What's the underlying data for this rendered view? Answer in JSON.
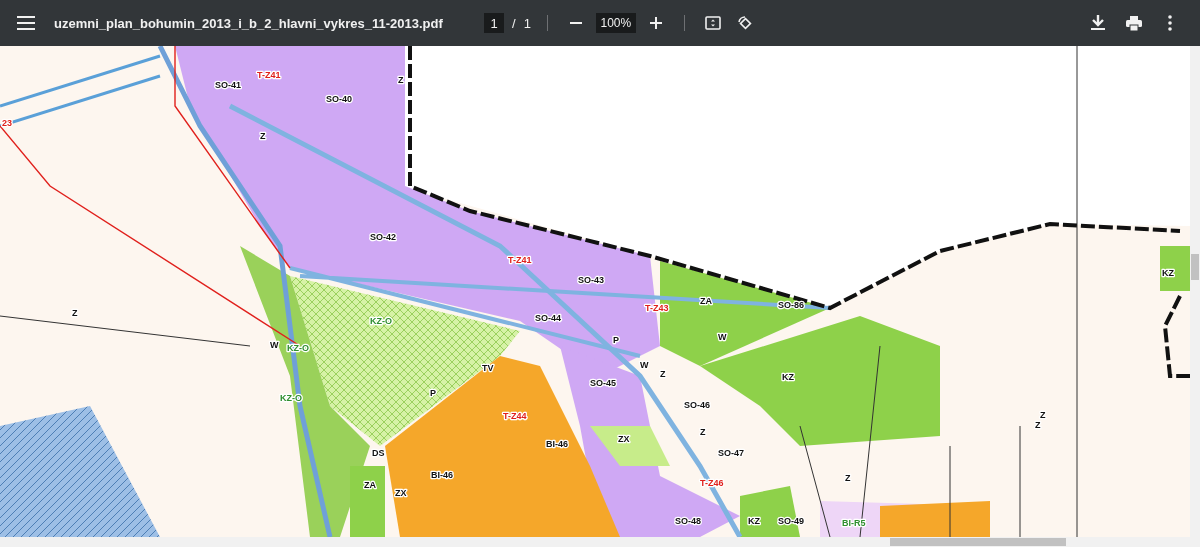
{
  "toolbar": {
    "title": "uzemni_plan_bohumin_2013_i_b_2_hlavni_vykres_11-2013.pdf",
    "page_current": "1",
    "page_separator": "/",
    "page_total": "1",
    "zoom": "100%"
  },
  "map_labels": [
    {
      "text": "SO-41",
      "kind": "zone"
    },
    {
      "text": "T-Z41",
      "kind": "plot"
    },
    {
      "text": "SO-40",
      "kind": "zone"
    },
    {
      "text": "Z",
      "kind": "zone"
    },
    {
      "text": "Z",
      "kind": "zone"
    },
    {
      "text": "SO-42",
      "kind": "zone"
    },
    {
      "text": "T-Z41",
      "kind": "plot"
    },
    {
      "text": "SO-43",
      "kind": "zone"
    },
    {
      "text": "SO-44",
      "kind": "zone"
    },
    {
      "text": "T-Z43",
      "kind": "plot"
    },
    {
      "text": "ZA",
      "kind": "zone"
    },
    {
      "text": "SO-86",
      "kind": "zone"
    },
    {
      "text": "W",
      "kind": "zone"
    },
    {
      "text": "W",
      "kind": "zone"
    },
    {
      "text": "KZ",
      "kind": "zone"
    },
    {
      "text": "KZ",
      "kind": "zone"
    },
    {
      "text": "Z",
      "kind": "zone"
    },
    {
      "text": "KZ-O",
      "kind": "hatch"
    },
    {
      "text": "KZ-O",
      "kind": "hatch"
    },
    {
      "text": "KZ-O",
      "kind": "hatch"
    },
    {
      "text": "W",
      "kind": "zone"
    },
    {
      "text": "P",
      "kind": "zone"
    },
    {
      "text": "TV",
      "kind": "zone"
    },
    {
      "text": "T-Z44",
      "kind": "plot"
    },
    {
      "text": "BI-46",
      "kind": "zone"
    },
    {
      "text": "BI-46",
      "kind": "zone"
    },
    {
      "text": "SO-45",
      "kind": "zone"
    },
    {
      "text": "ZX",
      "kind": "zone"
    },
    {
      "text": "SO-46",
      "kind": "zone"
    },
    {
      "text": "SO-47",
      "kind": "zone"
    },
    {
      "text": "Z",
      "kind": "zone"
    },
    {
      "text": "DS",
      "kind": "zone"
    },
    {
      "text": "ZA",
      "kind": "zone"
    },
    {
      "text": "ZX",
      "kind": "zone"
    },
    {
      "text": "SO-48",
      "kind": "zone"
    },
    {
      "text": "KZ",
      "kind": "zone"
    },
    {
      "text": "SO-49",
      "kind": "zone"
    },
    {
      "text": "BI-R5",
      "kind": "hatch"
    },
    {
      "text": "Z",
      "kind": "zone"
    },
    {
      "text": "Z",
      "kind": "zone"
    },
    {
      "text": "Z",
      "kind": "zone"
    },
    {
      "text": "T-Z46",
      "kind": "plot"
    },
    {
      "text": "Z",
      "kind": "zone"
    },
    {
      "text": "P",
      "kind": "zone"
    },
    {
      "text": "23",
      "kind": "plot"
    }
  ]
}
